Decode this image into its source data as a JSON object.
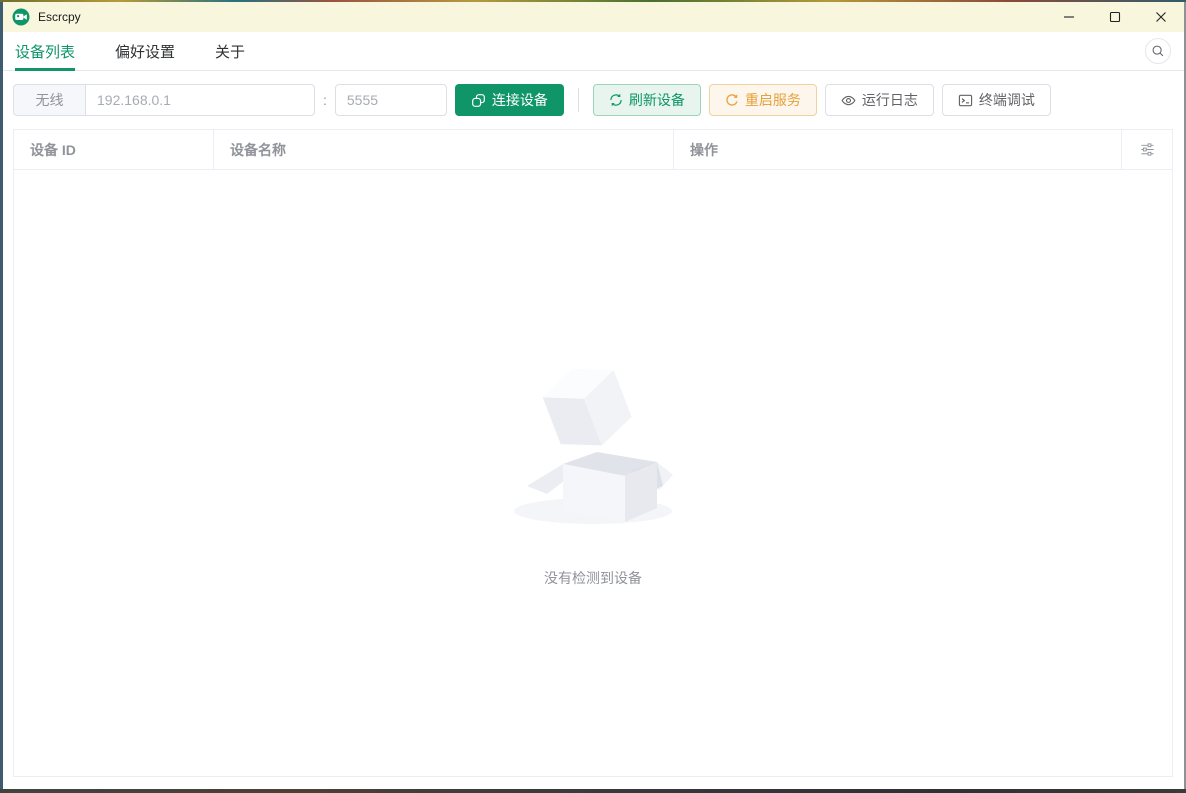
{
  "titlebar": {
    "title": "Escrcpy"
  },
  "tabs": {
    "items": [
      {
        "label": "设备列表"
      },
      {
        "label": "偏好设置"
      },
      {
        "label": "关于"
      }
    ],
    "active_index": 0
  },
  "toolbar": {
    "wireless_label": "无线",
    "ip_placeholder": "192.168.0.1",
    "separator": ":",
    "port_placeholder": "5555",
    "connect_label": "连接设备",
    "refresh_label": "刷新设备",
    "restart_label": "重启服务",
    "logs_label": "运行日志",
    "terminal_label": "终端调试"
  },
  "table": {
    "columns": [
      {
        "label": "设备 ID"
      },
      {
        "label": "设备名称"
      },
      {
        "label": "操作"
      }
    ],
    "rows": []
  },
  "empty_state": {
    "description": "没有检测到设备"
  },
  "icons": {
    "app": "video-camera-circle",
    "connect": "link-squares",
    "refresh": "refresh-arrows",
    "restart": "refresh-right-arrow",
    "logs": "eye",
    "terminal": "terminal-window",
    "search": "magnifier",
    "column_settings": "sliders",
    "window_controls": [
      "minimize",
      "maximize",
      "close"
    ]
  },
  "colors": {
    "primary": "#0f9568",
    "warning": "#e6a23c",
    "titlebar_bg": "#f8f6dd"
  }
}
